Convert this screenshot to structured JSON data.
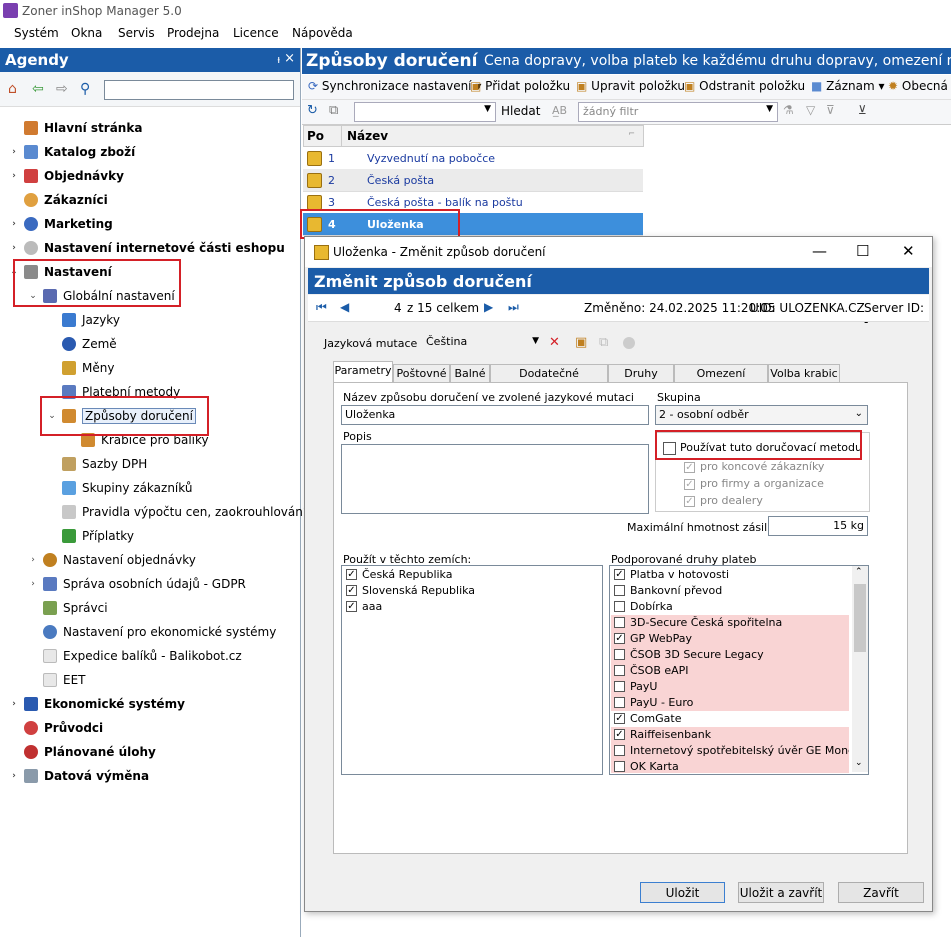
{
  "window": {
    "title": "Zoner inShop Manager 5.0"
  },
  "menu": [
    "Systém",
    "Okna",
    "Servis",
    "Prodejna",
    "Licence",
    "Nápověda"
  ],
  "agendy": {
    "title": "Agendy",
    "pin": "ᵼ",
    "close": "×",
    "search_value": "",
    "items": [
      {
        "label": "Hlavní stránka",
        "exp": "",
        "bold": true
      },
      {
        "label": "Katalog zboží",
        "exp": "›",
        "bold": true
      },
      {
        "label": "Objednávky",
        "exp": "›",
        "bold": true
      },
      {
        "label": "Zákazníci",
        "exp": "",
        "bold": true
      },
      {
        "label": "Marketing",
        "exp": "›",
        "bold": true
      },
      {
        "label": "Nastavení internetové části eshopu",
        "exp": "›",
        "bold": true
      },
      {
        "label": "Nastavení",
        "exp": "⌄",
        "bold": true
      },
      {
        "label": "Globální nastavení",
        "exp": "⌄",
        "bold": false
      },
      {
        "label": "Jazyky",
        "exp": "",
        "bold": false
      },
      {
        "label": "Země",
        "exp": "",
        "bold": false
      },
      {
        "label": "Měny",
        "exp": "",
        "bold": false
      },
      {
        "label": "Platební metody",
        "exp": "",
        "bold": false
      },
      {
        "label": "Způsoby doručení",
        "exp": "⌄",
        "bold": false
      },
      {
        "label": "Krabice pro balíky",
        "exp": "",
        "bold": false
      },
      {
        "label": "Sazby DPH",
        "exp": "",
        "bold": false
      },
      {
        "label": "Skupiny zákazníků",
        "exp": "",
        "bold": false
      },
      {
        "label": "Pravidla výpočtu cen, zaokrouhlování",
        "exp": "",
        "bold": false
      },
      {
        "label": "Příplatky",
        "exp": "",
        "bold": false
      },
      {
        "label": "Nastavení objednávky",
        "exp": "›",
        "bold": false
      },
      {
        "label": "Správa osobních údajů - GDPR",
        "exp": "›",
        "bold": false
      },
      {
        "label": "Správci",
        "exp": "",
        "bold": false
      },
      {
        "label": "Nastavení pro ekonomické systémy",
        "exp": "",
        "bold": false
      },
      {
        "label": "Expedice balíků - Balikobot.cz",
        "exp": "",
        "bold": false
      },
      {
        "label": "EET",
        "exp": "",
        "bold": false
      },
      {
        "label": "Ekonomické systémy",
        "exp": "›",
        "bold": true
      },
      {
        "label": "Průvodci",
        "exp": "",
        "bold": true
      },
      {
        "label": "Plánované úlohy",
        "exp": "",
        "bold": true
      },
      {
        "label": "Datová výměna",
        "exp": "›",
        "bold": true
      }
    ]
  },
  "main": {
    "title": "Způsoby doručení",
    "description": "Cena dopravy, volba plateb ke každému druhu dopravy, omezení na zem",
    "toolbar": {
      "sync": "Synchronizace nastavení",
      "add": "Přidat položku",
      "edit": "Upravit položku",
      "remove": "Odstranit položku",
      "record": "Záznam",
      "general": "Obecná"
    },
    "search_label": "Hledat",
    "filter_placeholder": "žádný filtr",
    "grid": {
      "col_po": "Po",
      "col_name": "Název",
      "rows": [
        {
          "n": "1",
          "name": "Vyzvednutí na pobočce"
        },
        {
          "n": "2",
          "name": "Česká pošta"
        },
        {
          "n": "3",
          "name": "Česká pošta - balík na poštu"
        },
        {
          "n": "4",
          "name": "Uloženka"
        }
      ]
    }
  },
  "dialog": {
    "title": "Uloženka - Změnit způsob doručení",
    "header": "Změnit způsob doručení",
    "nav": {
      "position": "4",
      "of_total": "z 15 celkem",
      "changed": "Změněno: 24.02.2025 11:20:05",
      "uid": "UID: ULOZENKA.CZ",
      "server": "Server ID: -"
    },
    "lang_label": "Jazyková mutace",
    "lang_value": "Čeština",
    "tabs": [
      "Parametry",
      "Poštovné",
      "Balné",
      "Dodatečné nastavení",
      "Druhy zboží",
      "Omezení rozměrů",
      "Volba krabic"
    ],
    "name_label": "Název způsobu doručení ve zvolené jazykové mutaci",
    "name_value": "Uloženka",
    "group_label": "Skupina",
    "group_value": "2 - osobní odběr",
    "desc_label": "Popis",
    "use_method": "Používat tuto doručovací metodu",
    "for_end": "pro koncové zákazníky",
    "for_firms": "pro firmy a organizace",
    "for_dealers": "pro dealery",
    "max_weight_label": "Maximální hmotnost zásilky",
    "max_weight_value": "15 kg",
    "countries_label": "Použít v těchto zemích:",
    "countries": [
      {
        "name": "Česká Republika",
        "checked": true
      },
      {
        "name": "Slovenská Republika",
        "checked": true
      },
      {
        "name": "aaa",
        "checked": true
      }
    ],
    "payments_label": "Podporované druhy plateb",
    "payments": [
      {
        "name": "Platba v hotovosti",
        "checked": true,
        "pink": false
      },
      {
        "name": "Bankovní převod",
        "checked": false,
        "pink": false
      },
      {
        "name": "Dobírka",
        "checked": false,
        "pink": false
      },
      {
        "name": "3D-Secure Česká spořitelna",
        "checked": false,
        "pink": true
      },
      {
        "name": "GP WebPay",
        "checked": true,
        "pink": true
      },
      {
        "name": "ČSOB 3D Secure Legacy",
        "checked": false,
        "pink": true
      },
      {
        "name": "ČSOB eAPI",
        "checked": false,
        "pink": true
      },
      {
        "name": "PayU",
        "checked": false,
        "pink": true
      },
      {
        "name": "PayU - Euro",
        "checked": false,
        "pink": true
      },
      {
        "name": "ComGate",
        "checked": true,
        "pink": false
      },
      {
        "name": "Raiffeisenbank",
        "checked": true,
        "pink": true
      },
      {
        "name": "Internetový spotřebitelský úvěr GE Money M",
        "checked": false,
        "pink": true
      },
      {
        "name": "OK Karta",
        "checked": false,
        "pink": true
      }
    ],
    "buttons": {
      "save": "Uložit",
      "save_close": "Uložit a zavřít",
      "close": "Zavřít"
    }
  },
  "colors": {
    "accent": "#1b5ca8",
    "selection": "#3d8fdc",
    "highlight_box": "#d42027",
    "pink_row": "#f9d4d4"
  }
}
